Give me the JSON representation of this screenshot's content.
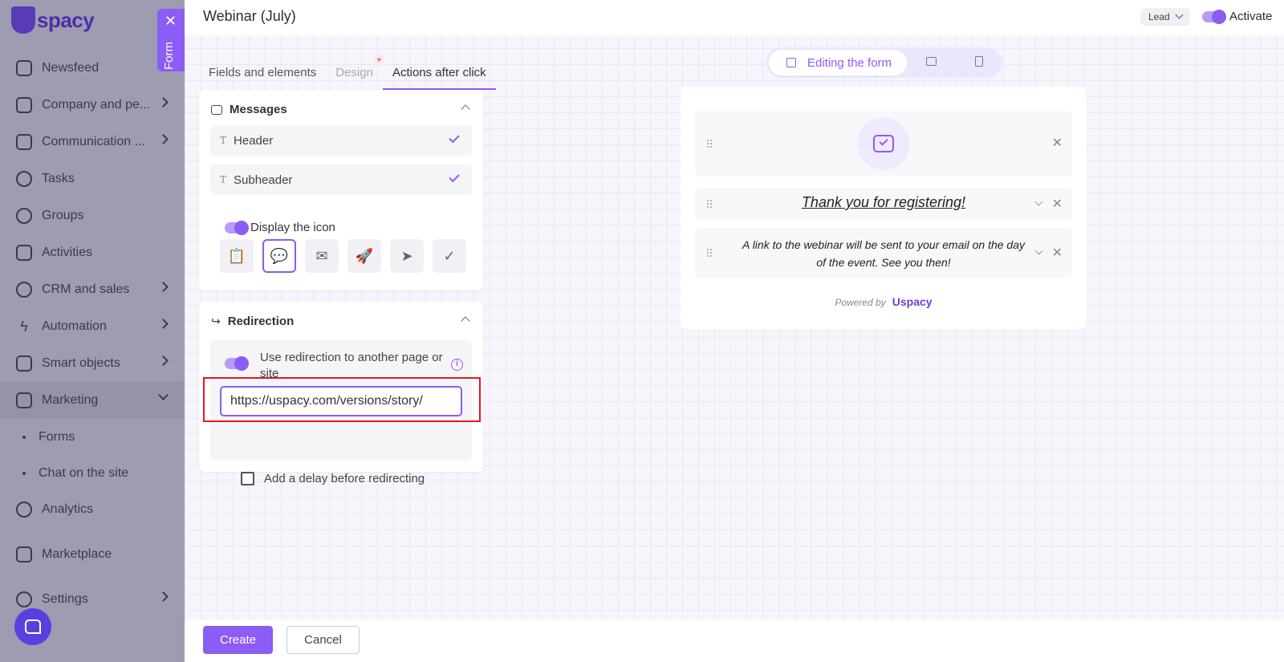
{
  "app": {
    "brand": "Uspacy",
    "logo_text": "spacy"
  },
  "sidebar": {
    "items": [
      {
        "label": "Newsfeed",
        "icon": "home-icon",
        "has_children": false
      },
      {
        "label": "Company and pe...",
        "icon": "building-icon",
        "has_children": true
      },
      {
        "label": "Communication ...",
        "icon": "chat-icon",
        "has_children": true
      },
      {
        "label": "Tasks",
        "icon": "check-circle-icon",
        "has_children": false
      },
      {
        "label": "Groups",
        "icon": "users-icon",
        "has_children": false
      },
      {
        "label": "Activities",
        "icon": "calendar-icon",
        "has_children": false
      },
      {
        "label": "CRM and sales",
        "icon": "coins-icon",
        "has_children": true
      },
      {
        "label": "Automation",
        "icon": "lightning-icon",
        "has_children": true
      },
      {
        "label": "Smart objects",
        "icon": "smart-object-icon",
        "has_children": true
      },
      {
        "label": "Marketing",
        "icon": "megaphone-icon",
        "has_children": true,
        "expanded": true
      }
    ],
    "marketing_sub": [
      "Forms",
      "Chat on the site"
    ],
    "bottom_items": [
      {
        "label": "Analytics",
        "icon": "chart-icon"
      },
      {
        "label": "Marketplace",
        "icon": "store-icon"
      },
      {
        "label": "Settings",
        "icon": "gear-icon"
      }
    ]
  },
  "form_tab": {
    "label": "Form",
    "close": "✕"
  },
  "header": {
    "title": "Webinar (July)",
    "entity_select": "Lead",
    "activate_label": "Activate",
    "activate_on": true
  },
  "tabs": [
    "Fields and elements",
    "Design",
    "Actions after click"
  ],
  "messages": {
    "title": "Messages",
    "rows": [
      {
        "type": "T",
        "label": "Header"
      },
      {
        "type": "T",
        "label": "Subheader"
      }
    ],
    "display_icon_label": "Display the icon",
    "icons": [
      "clipboard-icon",
      "chat-check-icon",
      "mail-icon",
      "rocket-icon",
      "send-icon",
      "check-icon"
    ],
    "selected_icon": "chat-check-icon"
  },
  "redirection": {
    "title": "Redirection",
    "toggle_label": "Use redirection to another page or site",
    "url_value": "https://uspacy.com/versions/story/",
    "delay_label": "Add a delay before redirecting"
  },
  "preview_switch": {
    "editing_label": "Editing the form"
  },
  "preview": {
    "thank_you": "Thank you for registering!",
    "subtext": "A link to the webinar will be sent to your email on the day of the event. See you then!",
    "powered_by": "Powered by",
    "powered_brand": "spacy"
  },
  "footer": {
    "create": "Create",
    "cancel": "Cancel"
  },
  "colors": {
    "accent": "#8b5cf6",
    "highlight": "#e0191f"
  }
}
